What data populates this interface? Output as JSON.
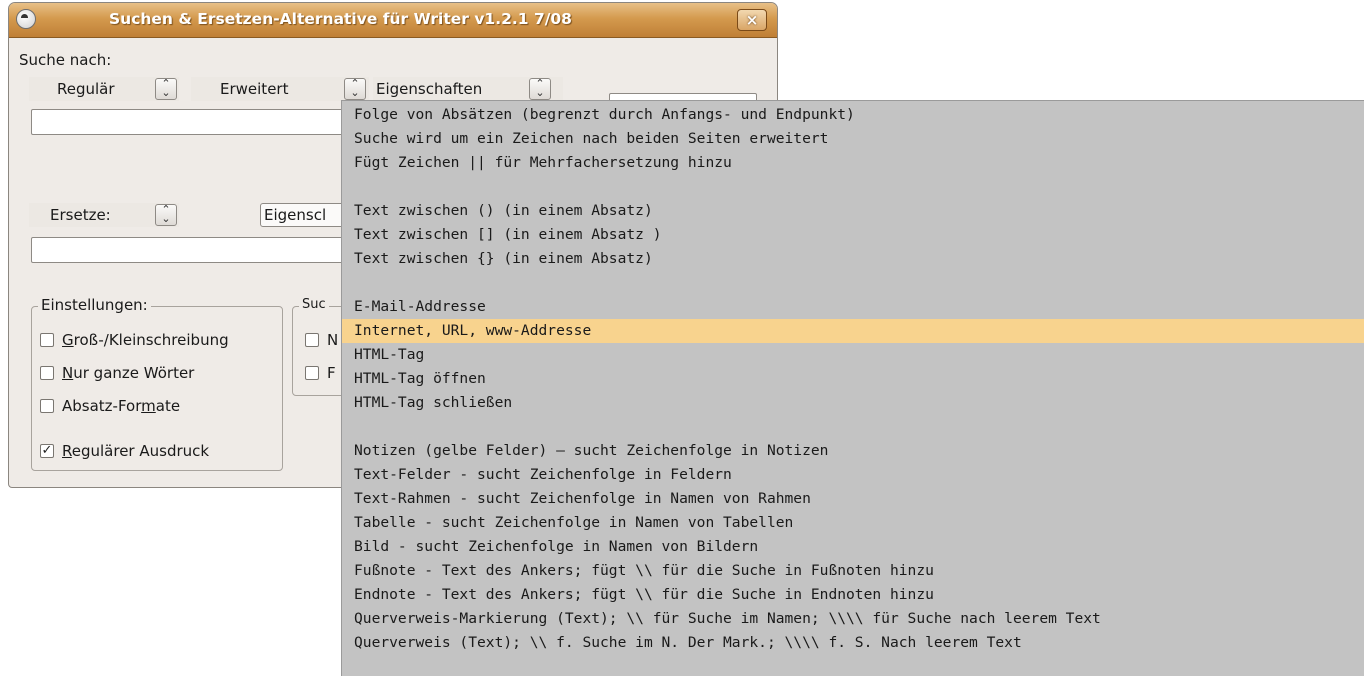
{
  "window": {
    "title": "Suchen & Ersetzen-Alternative für Writer  v1.2.1  7/08",
    "close_glyph": "×"
  },
  "search": {
    "label": "Suche nach:",
    "combo_regular": "Regulär",
    "combo_extended": "Erweitert",
    "combo_properties": "Eigenschaften",
    "value": ""
  },
  "replace": {
    "label": "Ersetze:",
    "combo_properties": "Eigenscl",
    "value": ""
  },
  "settings": {
    "legend": "Einstellungen:",
    "options": [
      {
        "pre": "",
        "u": "G",
        "post": "roß-/Kleinschreibung",
        "checked": false
      },
      {
        "pre": "",
        "u": "N",
        "post": "ur ganze Wörter",
        "checked": false
      },
      {
        "pre": "Absatz-For",
        "u": "m",
        "post": "ate",
        "checked": false
      },
      {
        "pre": "",
        "u": "R",
        "post": "egulärer Ausdruck",
        "checked": true
      }
    ]
  },
  "search_in": {
    "legend": "Suc",
    "options": [
      {
        "text": "N",
        "checked": false
      },
      {
        "text": "F",
        "checked": false
      }
    ]
  },
  "dropdown": {
    "selected_index": 9,
    "items": [
      "Folge von Absätzen (begrenzt durch Anfangs- und Endpunkt)",
      "Suche wird um ein Zeichen nach beiden Seiten erweitert",
      "Fügt Zeichen || für Mehrfachersetzung hinzu",
      "",
      "Text zwischen () (in einem Absatz)",
      "Text zwischen [] (in einem Absatz )",
      "Text zwischen {} (in einem Absatz)",
      "",
      "E-Mail-Addresse",
      "Internet, URL, www-Addresse",
      "HTML-Tag",
      "HTML-Tag öffnen",
      "HTML-Tag schließen",
      "",
      "Notizen (gelbe Felder) – sucht Zeichenfolge in Notizen",
      "Text-Felder - sucht Zeichenfolge in Feldern",
      "Text-Rahmen - sucht Zeichenfolge in Namen von Rahmen",
      "Tabelle - sucht Zeichenfolge in Namen von Tabellen",
      "Bild - sucht Zeichenfolge in Namen von Bildern",
      "Fußnote - Text des Ankers; fügt \\\\ für die Suche in Fußnoten hinzu",
      "Endnote - Text des Ankers; fügt \\\\ für die Suche in Endnoten hinzu",
      "Querverweis-Markierung (Text); \\\\ für Suche im Namen; \\\\\\\\ für Suche nach leerem Text",
      "Querverweis (Text); \\\\ f. Suche im N. Der Mark.; \\\\\\\\ f. S. Nach leerem Text"
    ]
  },
  "colors": {
    "titlebar": "#d49a4e",
    "dialog_bg": "#efebe7",
    "dropdown_bg": "#c3c3c3",
    "selection": "#f8d38e"
  },
  "icons": {
    "window": "gnome-window-icon",
    "close": "close-icon",
    "spinner": "combo-arrows-icon",
    "check": "checkmark-icon"
  }
}
